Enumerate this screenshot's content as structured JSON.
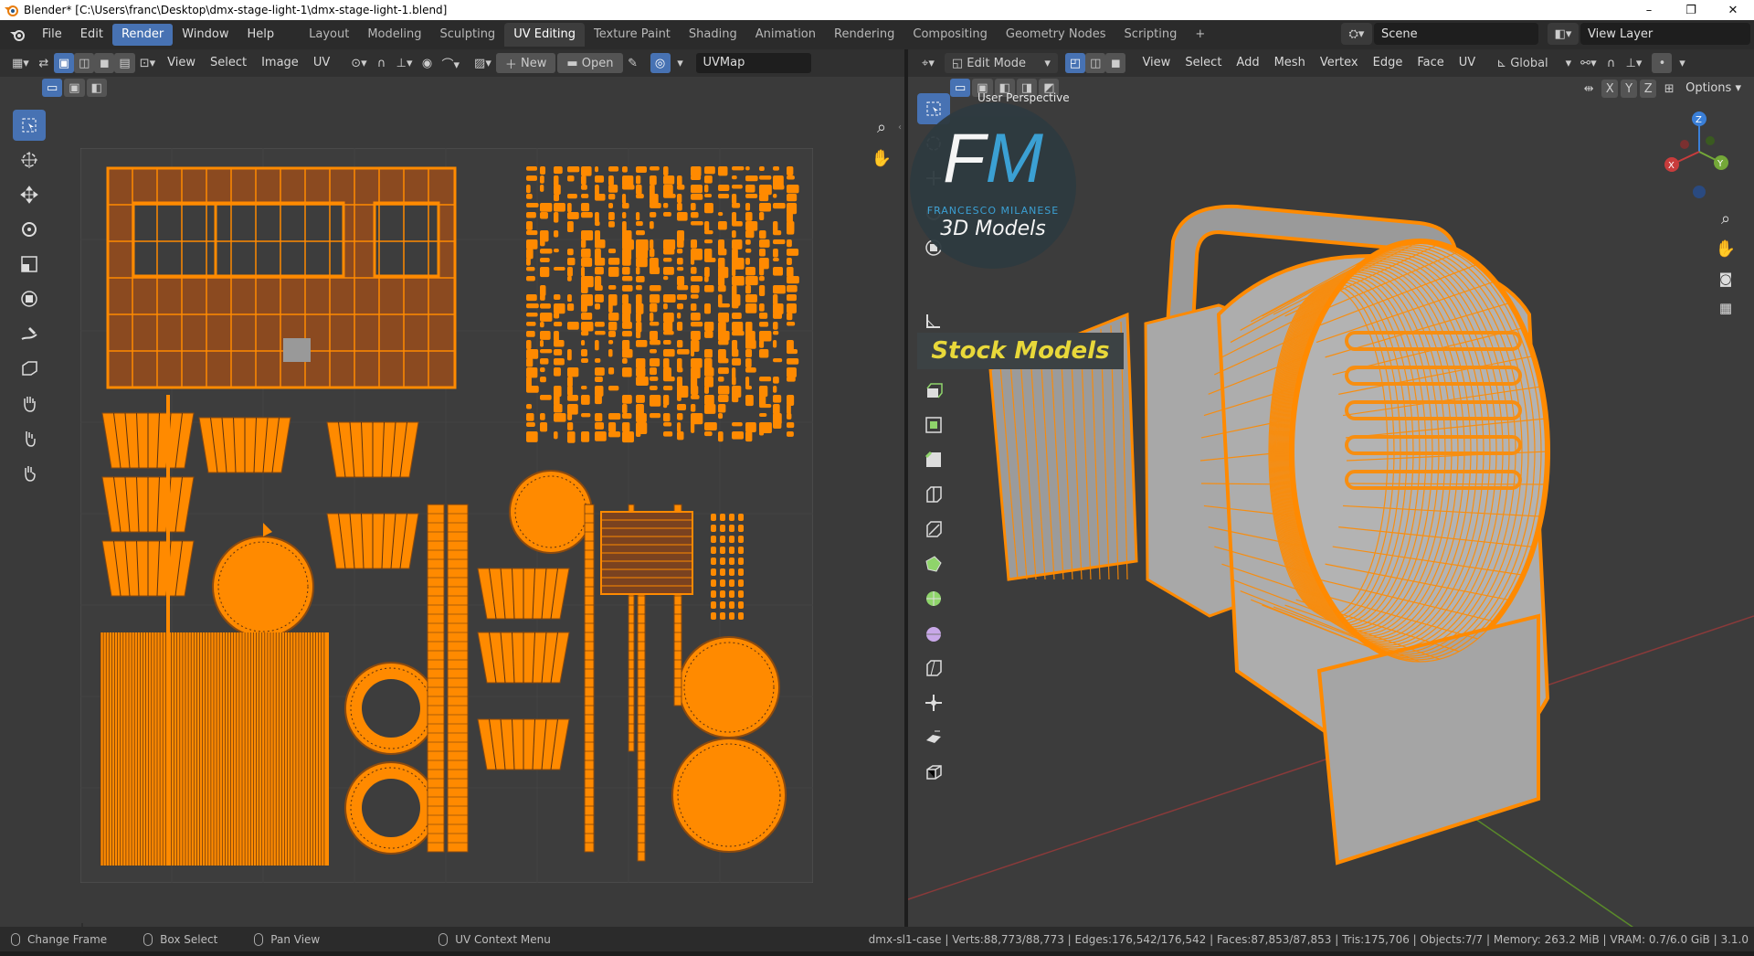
{
  "window": {
    "title": "Blender* [C:\\Users\\franc\\Desktop\\dmx-stage-light-1\\dmx-stage-light-1.blend]",
    "min_glyph": "–",
    "max_glyph": "❐",
    "close_glyph": "✕"
  },
  "menus": [
    "File",
    "Edit",
    "Render",
    "Window",
    "Help"
  ],
  "active_menu": "Render",
  "workspaces": [
    "Layout",
    "Modeling",
    "Sculpting",
    "UV Editing",
    "Texture Paint",
    "Shading",
    "Animation",
    "Rendering",
    "Compositing",
    "Geometry Nodes",
    "Scripting"
  ],
  "active_workspace": "UV Editing",
  "add_workspace": "+",
  "scene": {
    "label": "Scene",
    "view_layer": "View Layer"
  },
  "uv_editor": {
    "menu": [
      "View",
      "Select",
      "Image",
      "UV"
    ],
    "new_label": "New",
    "open_label": "Open",
    "uvmap": "UVMap"
  },
  "viewport": {
    "mode": "Edit Mode",
    "menu": [
      "View",
      "Select",
      "Add",
      "Mesh",
      "Vertex",
      "Edge",
      "Face",
      "UV"
    ],
    "transform": "Global",
    "axes": [
      "X",
      "Y",
      "Z"
    ],
    "options": "Options",
    "overlay_label": "User Perspective"
  },
  "watermark": {
    "logo_letters": "FM",
    "author": "FRANCESCO MILANESE",
    "tagline": "3D Models",
    "banner": "Stock Models"
  },
  "status": {
    "items": [
      "Change Frame",
      "Box Select",
      "Pan View",
      "UV Context Menu"
    ],
    "stats": "dmx-sl1-case | Verts:88,773/88,773 | Edges:176,542/176,542 | Faces:87,853/87,853 | Tris:175,706 | Objects:7/7 | Memory: 263.2 MiB | VRAM: 0.7/6.0 GiB | 3.1.0"
  },
  "colors": {
    "accent": "#4772b3",
    "uv_orange": "#ff8a00",
    "panel": "#303030",
    "viewport_bg": "#3c3c3c"
  }
}
